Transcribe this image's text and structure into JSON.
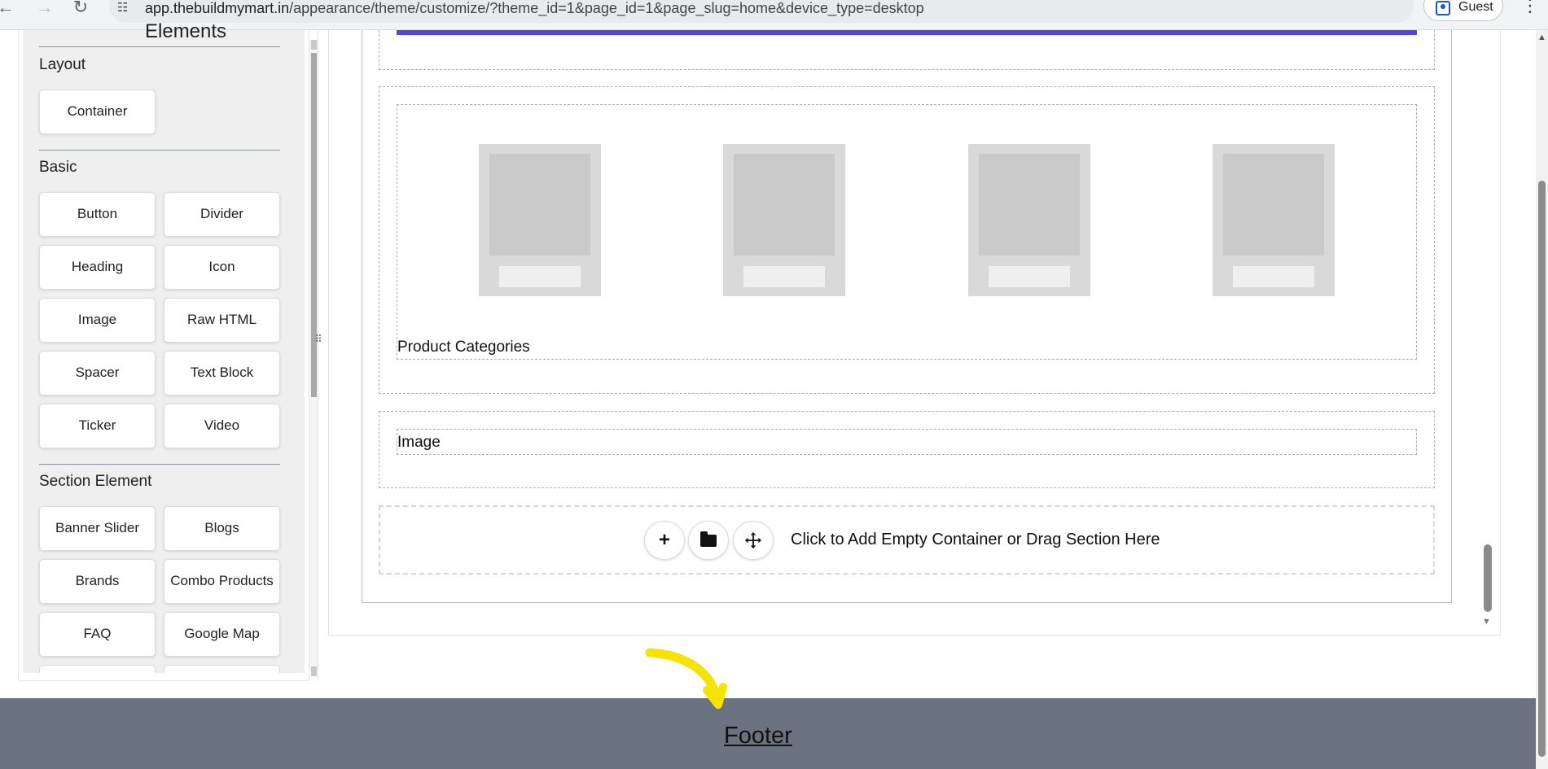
{
  "browser": {
    "url_host": "app.thebuildmymart.in",
    "url_path": "/appearance/theme/customize/?theme_id=1&page_id=1&page_slug=home&device_type=desktop",
    "profile_label": "Guest",
    "icons": [
      "back-arrow-icon",
      "forward-arrow-icon",
      "reload-icon",
      "site-info-icon",
      "profile-icon",
      "kebab-menu-icon"
    ]
  },
  "elements_panel": {
    "title": "Elements",
    "sections": [
      {
        "label": "Layout",
        "items": [
          "Container"
        ]
      },
      {
        "label": "Basic",
        "items": [
          "Button",
          "Divider",
          "Heading",
          "Icon",
          "Image",
          "Raw HTML",
          "Spacer",
          "Text Block",
          "Ticker",
          "Video"
        ]
      },
      {
        "label": "Section Element",
        "items": [
          "Banner Slider",
          "Blogs",
          "Brands",
          "Combo Products",
          "FAQ",
          "Google Map"
        ]
      }
    ]
  },
  "canvas": {
    "product_categories_label": "Product Categories",
    "category_placeholder_count": 4,
    "image_label": "Image",
    "add_container_text": "Click to Add Empty Container or Drag Section Here",
    "add_buttons": [
      "plus-icon",
      "folder-icon",
      "move-icon"
    ],
    "accent_color": "#4f46e5"
  },
  "footer": {
    "link_text": "Footer",
    "background": "#6b7280"
  },
  "annotation": {
    "color": "#f5e400"
  }
}
